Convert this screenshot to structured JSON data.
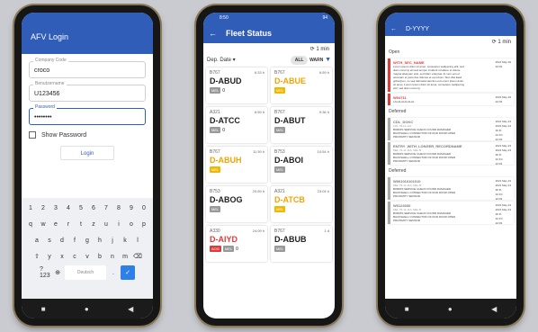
{
  "login": {
    "title": "AFV Login",
    "company_label": "Company Code",
    "company_value": "croco",
    "user_label": "Benutzername",
    "user_value": "U123456",
    "password_label": "Password",
    "password_value": "••••••••",
    "show_password": "Show Password",
    "login_button": "Login",
    "keyboard_rows": [
      [
        "1",
        "2",
        "3",
        "4",
        "5",
        "6",
        "7",
        "8",
        "9",
        "0"
      ],
      [
        "q",
        "w",
        "e",
        "r",
        "t",
        "z",
        "u",
        "i",
        "o",
        "p"
      ],
      [
        "a",
        "s",
        "d",
        "f",
        "g",
        "h",
        "j",
        "k",
        "l"
      ],
      [
        "⇧",
        "y",
        "x",
        "c",
        "v",
        "b",
        "n",
        "m",
        "⌫"
      ]
    ],
    "kbd_123": "?123",
    "kbd_space": "Deutsch",
    "kbd_enter": "✓"
  },
  "fleet": {
    "status_time": "8:50",
    "status_batt": "94",
    "title": "Fleet Status",
    "refresh": "⟳ 1 min",
    "sort_label": "Dep. Date ▾",
    "filter_all": "ALL",
    "filter_warn": "WARN",
    "cards": [
      {
        "type": "B767",
        "time": "6:33 h",
        "reg": "D-ABUD",
        "color": "",
        "badges": [
          {
            "t": "MEL",
            "c": "b-mel"
          }
        ],
        "count": "0"
      },
      {
        "type": "B767",
        "time": "6:59 h",
        "reg": "D-ABUE",
        "color": "orange",
        "badges": [
          {
            "t": "MEL",
            "c": "b-yel"
          }
        ],
        "count": ""
      },
      {
        "type": "A321",
        "time": "6:59 h",
        "reg": "D-ATCC",
        "color": "",
        "badges": [
          {
            "t": "MEL",
            "c": "b-mel"
          }
        ],
        "count": "0"
      },
      {
        "type": "B767",
        "time": "9:36 h",
        "reg": "D-ABUT",
        "color": "",
        "badges": [
          {
            "t": "MEL",
            "c": "b-mel"
          }
        ],
        "count": ""
      },
      {
        "type": "B767",
        "time": "11:39 h",
        "reg": "D-ABUH",
        "color": "orange",
        "badges": [
          {
            "t": "MEL",
            "c": "b-yel"
          }
        ],
        "count": ""
      },
      {
        "type": "B753",
        "time": "10:54 h",
        "reg": "D-ABOI",
        "color": "",
        "badges": [
          {
            "t": "MEL",
            "c": "b-mel"
          }
        ],
        "count": ""
      },
      {
        "type": "B753",
        "time": "20:59 h",
        "reg": "D-ABOG",
        "color": "",
        "badges": [
          {
            "t": "MEL",
            "c": "b-mel"
          }
        ],
        "count": ""
      },
      {
        "type": "A321",
        "time": "23:04 h",
        "reg": "D-ATCB",
        "color": "orange",
        "badges": [
          {
            "t": "MEL",
            "c": "b-yel"
          }
        ],
        "count": ""
      },
      {
        "type": "A330",
        "time": "24:09 h",
        "reg": "D-AIYD",
        "color": "red",
        "badges": [
          {
            "t": "AOG",
            "c": "b-red"
          },
          {
            "t": "MEL",
            "c": "b-mel"
          }
        ],
        "count": "0"
      },
      {
        "type": "B767",
        "time": "1 d",
        "reg": "D-ABUB",
        "color": "",
        "badges": [
          {
            "t": "MEL",
            "c": "b-mel"
          }
        ],
        "count": ""
      }
    ]
  },
  "detail": {
    "title": "D-YYYY",
    "refresh": "⟳ 1 min",
    "sections": [
      {
        "label": "Open",
        "items": [
          {
            "title": "WITH_SEC_NAME",
            "grey": false,
            "red": true,
            "sub": "",
            "desc": "Lorem ipsum dolor sit amet, consetetur sadipscing elitr, sed diam nonumy eirmod tempor invidunt ut labore et dolore magna aliquyam erat, sed diam voluptua. At vero eos et accusam et justo duo dolores et ea rebum. Stet clita kasd gubergren, no sea takimata sanctus est Lorem ipsum dolor sit amet. Lorem ipsum dolor sit amet, consetetur sadipscing elitr, sed diam nonumy",
            "meta": [
              "2021 May 29",
              "22:03"
            ]
          },
          {
            "title": "W04711",
            "grey": false,
            "red": true,
            "sub": "",
            "desc": "LALALALALALAL",
            "meta": [
              "2021 May 29",
              "22:03"
            ]
          }
        ]
      },
      {
        "label": "Deferred",
        "items": [
          {
            "title": "CDL_DOKC",
            "grey": true,
            "red": false,
            "sub": "CDL 79-11-11A",
            "desc": "BURRIS SERVICE CHECK FOUND DAMAGED BACKSHELL CONNECTOR OF RUD DOOR OPEN PROXIMITY SENSOR",
            "meta": [
              "2021 May 23",
              "2021 May 24",
              "30 fh",
              "34 FC",
              "22:03"
            ]
          },
          {
            "title": "ENTRY_WITH_LONGER_RECORDNAME",
            "grey": true,
            "red": false,
            "sub": "MEL 79-11-11A, MEL B",
            "desc": "BURRIS SERVICE CHECK FOUND DAMAGED BACKSHELL CONNECTOR OF RUD DOOR OPEN PROXIMITY SENSOR",
            "meta": [
              "2021 May 23",
              "2021 May 24",
              "30 fh",
              "34 FC",
              "22:03"
            ]
          }
        ]
      },
      {
        "label": "Deferred",
        "items": [
          {
            "title": "W001010101010",
            "grey": true,
            "red": false,
            "sub": "MEL 79-11-11A, MEL B",
            "desc": "BURRIS SERVICE CHECK FOUND DAMAGED BACKSHELL CONNECTOR OF RUD DOOR OPEN PROXIMITY SENSOR",
            "meta": [
              "2021 May 23",
              "2021 May 24",
              "30 fh",
              "34 FC",
              "22:03"
            ]
          },
          {
            "title": "W0123330",
            "grey": true,
            "red": false,
            "sub": "MEL 79-11-11A, MEL B",
            "desc": "BURRIS SERVICE CHECK FOUND DAMAGED BACKSHELL CONNECTOR OF RUD DOOR OPEN PROXIMITY SENSOR",
            "meta": [
              "2021 May 23",
              "2021 May 24",
              "30 fh",
              "34 FC",
              "22:03"
            ]
          }
        ]
      }
    ]
  }
}
